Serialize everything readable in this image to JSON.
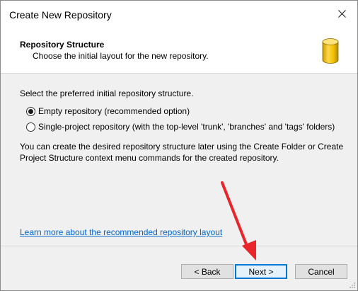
{
  "window": {
    "title": "Create New Repository",
    "close_glyph": "✕"
  },
  "header": {
    "title": "Repository Structure",
    "subtitle": "Choose the initial layout for the new repository.",
    "icon": "database-icon"
  },
  "content": {
    "prompt": "Select the preferred initial repository structure.",
    "options": [
      {
        "label": "Empty repository (recommended option)",
        "selected": true
      },
      {
        "label": "Single-project repository (with the top-level 'trunk', 'branches' and 'tags' folders)",
        "selected": false
      }
    ],
    "note": "You can create the desired repository structure later using the Create Folder or Create Project Structure context menu commands for the created repository.",
    "link": "Learn more about the recommended repository layout"
  },
  "buttons": {
    "back": "< Back",
    "next": "Next >",
    "cancel": "Cancel"
  },
  "colors": {
    "link": "#0066cc",
    "primary_border": "#0078d7",
    "annotation_arrow": "#e8262c",
    "db_icon": "#f2c200"
  }
}
